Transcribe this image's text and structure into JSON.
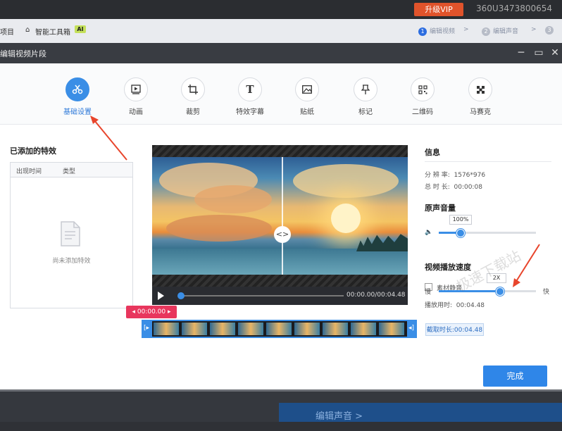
{
  "app": {
    "vip_label": "升级VIP",
    "user_id": "360U3473800654"
  },
  "toolbar": {
    "project_label": "项目",
    "smart_toolbox_label": "智能工具箱",
    "ai_badge": "AI",
    "steps": [
      {
        "num": "1",
        "label": "编辑视频"
      },
      {
        "num": "2",
        "label": "编辑声音"
      },
      {
        "num": "3",
        "label": ""
      }
    ]
  },
  "dialog": {
    "title": "编辑视频片段",
    "tabs": [
      {
        "label": "基础设置",
        "icon": "scissors-icon",
        "active": true
      },
      {
        "label": "动画",
        "icon": "play-frame-icon",
        "active": false
      },
      {
        "label": "裁剪",
        "icon": "crop-icon",
        "active": false
      },
      {
        "label": "特效字幕",
        "icon": "text-icon",
        "active": false
      },
      {
        "label": "贴纸",
        "icon": "image-icon",
        "active": false
      },
      {
        "label": "标记",
        "icon": "pin-icon",
        "active": false
      },
      {
        "label": "二维码",
        "icon": "qrcode-icon",
        "active": false
      },
      {
        "label": "马赛克",
        "icon": "mosaic-icon",
        "active": false
      }
    ],
    "effects": {
      "title": "已添加的特效",
      "col_time": "出现时间",
      "col_type": "类型",
      "empty_text": "尚未添加特效"
    },
    "player": {
      "time_display": "00:00.00/00:04.48",
      "progress": 0.0
    },
    "timeline": {
      "start_tag": "00:00.00",
      "cut_length": "截取时长:00:04.48",
      "frame_count": 9
    },
    "info": {
      "title": "信息",
      "resolution_label": "分 辨 率:",
      "resolution_value": "1576*976",
      "duration_label": "总 时 长:",
      "duration_value": "00:00:08"
    },
    "volume": {
      "title": "原声音量",
      "value": "100%",
      "level": 0.22,
      "mute_label": "素材静音"
    },
    "speed": {
      "title": "视频播放速度",
      "value": "2X",
      "slow_label": "慢",
      "fast_label": "快",
      "level": 0.62,
      "playtime_label": "播放用时:",
      "playtime_value": "00:04.48"
    },
    "done_label": "完成",
    "watermark": "极速下载站"
  },
  "bottom": {
    "next_label": "编辑声音 >"
  },
  "colors": {
    "accent": "#3a8ee6",
    "vip": "#e0532b",
    "tag": "#e8365d",
    "annotation_arrow": "#e8452c"
  }
}
